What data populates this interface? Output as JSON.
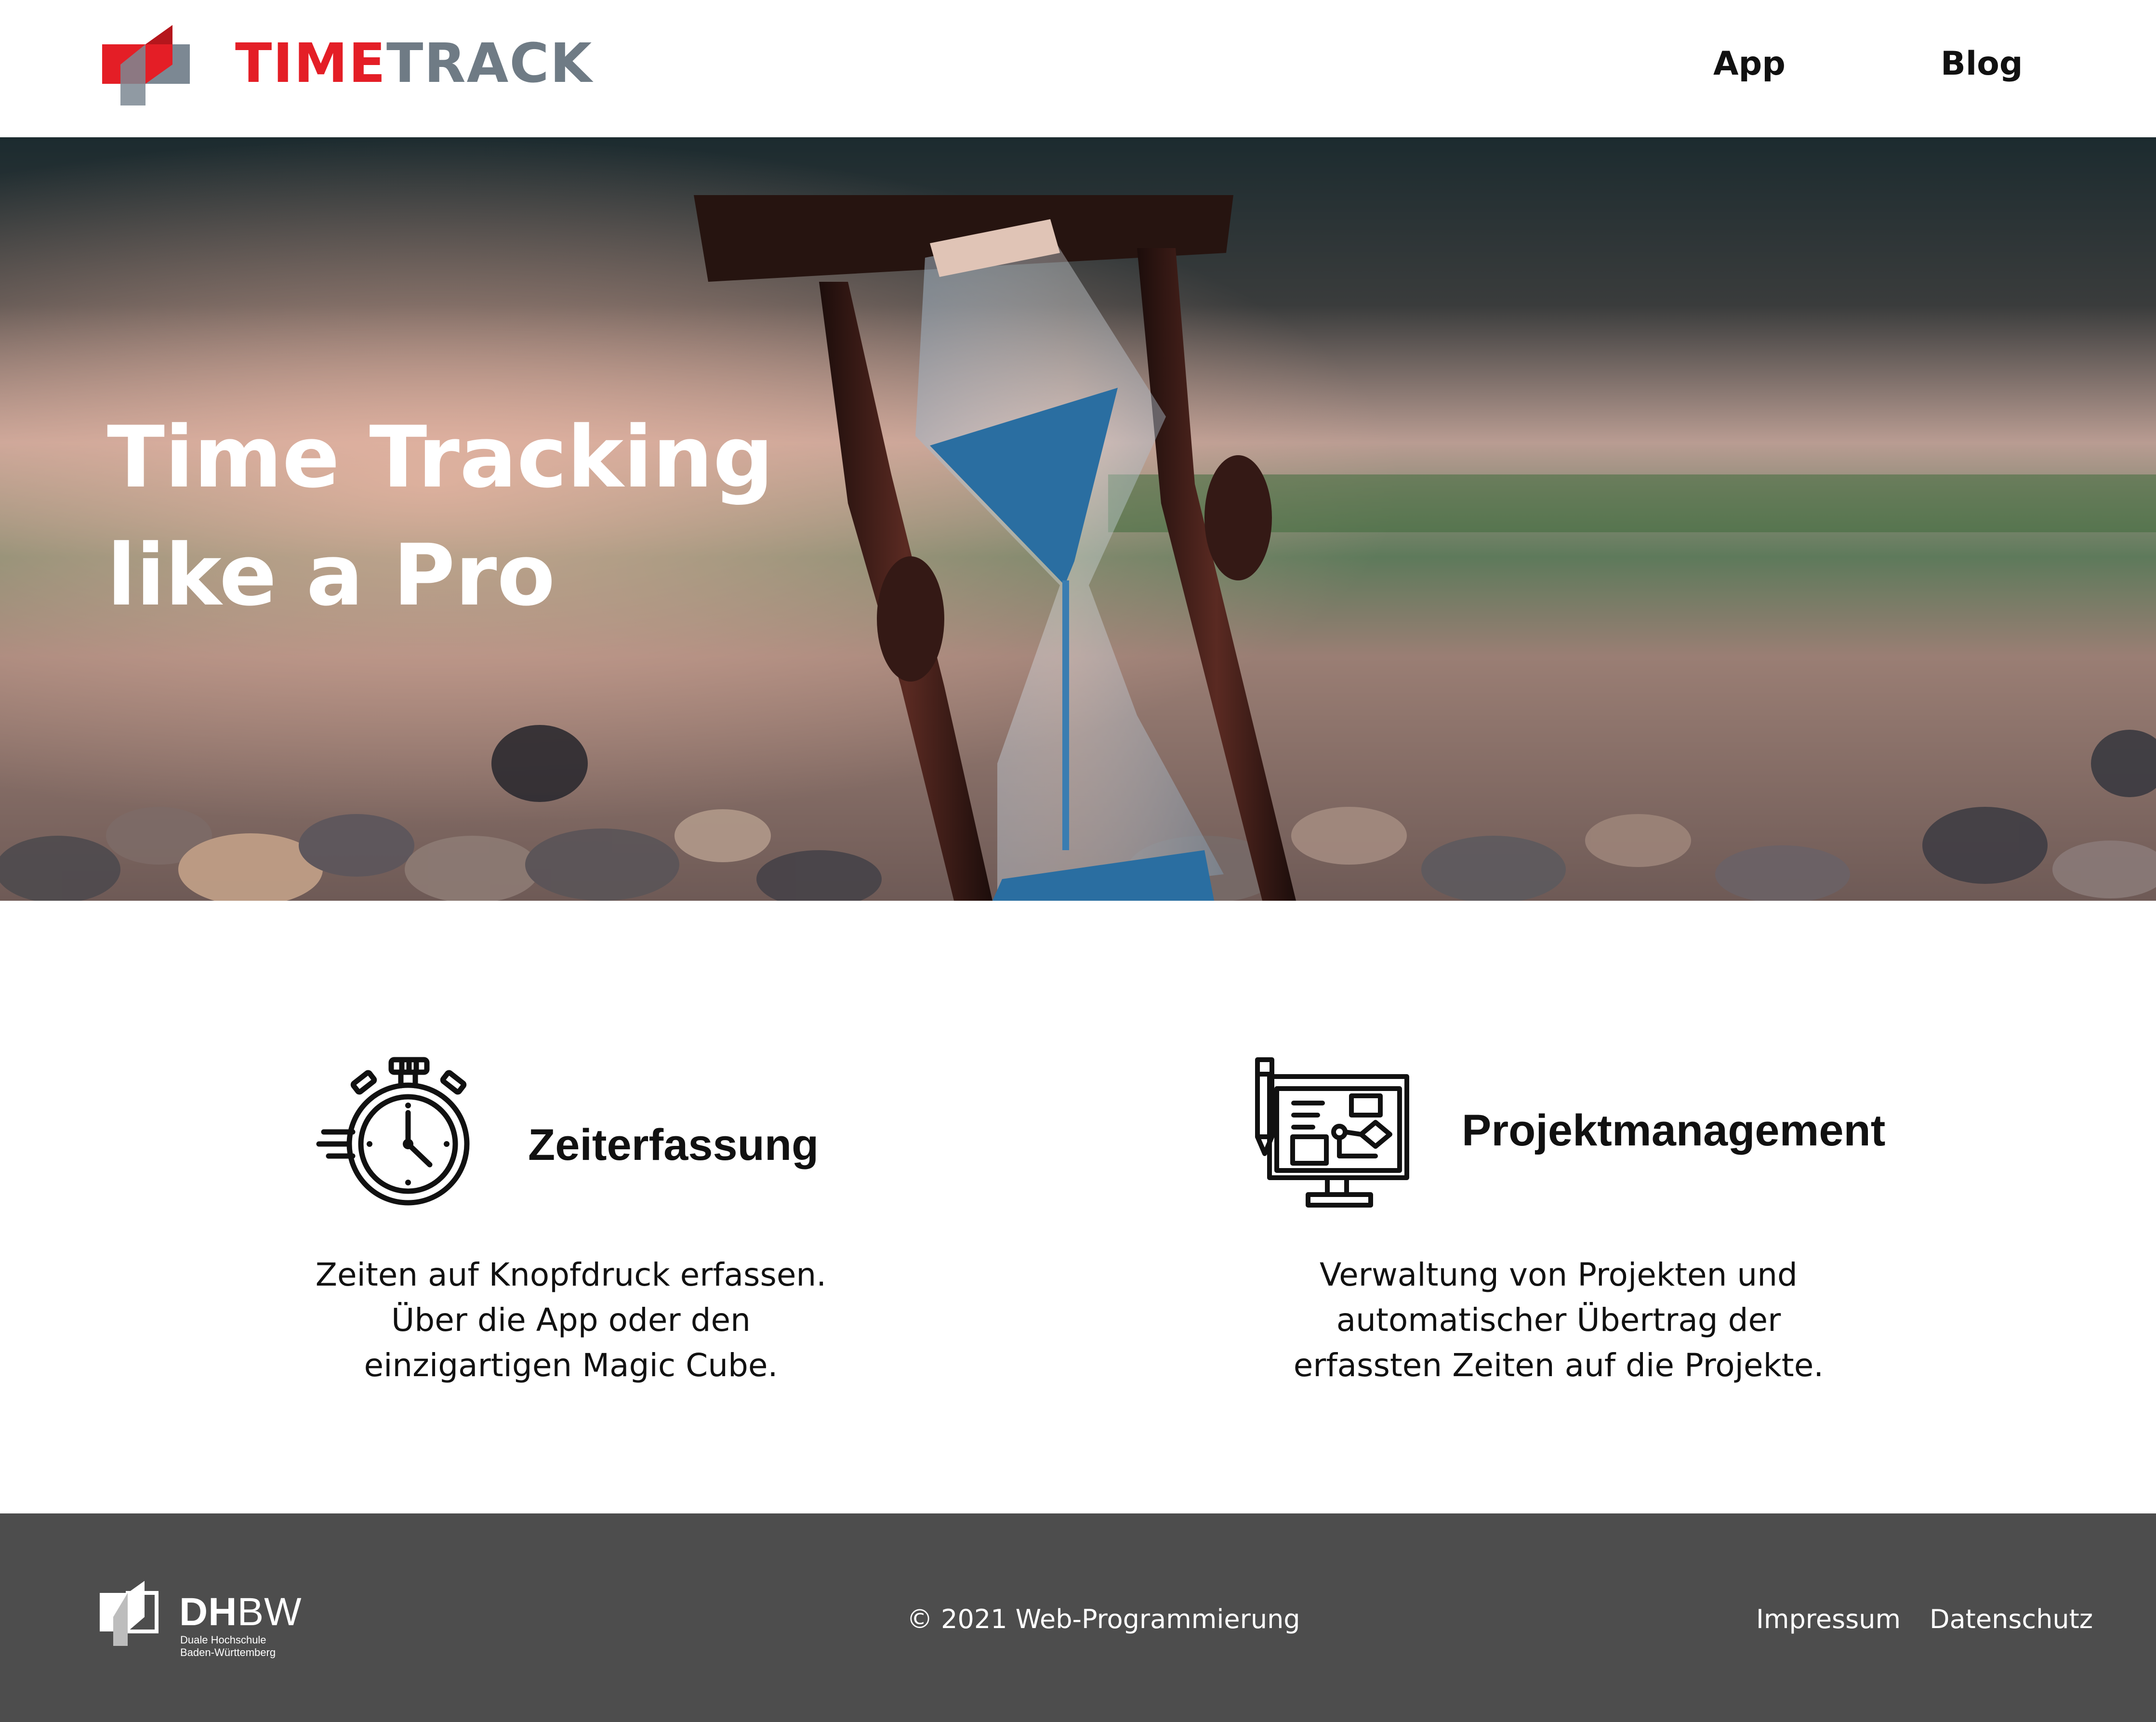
{
  "header": {
    "brand_part1": "TIME",
    "brand_part2": "TRACK",
    "nav": [
      {
        "label": "App"
      },
      {
        "label": "Blog"
      }
    ]
  },
  "hero": {
    "title_line1": "Time Tracking",
    "title_line2": "like a Pro"
  },
  "features": [
    {
      "icon": "stopwatch-icon",
      "title": "Zeiterfassung",
      "lines": [
        "Zeiten auf Knopfdruck erfassen.",
        "Über die App oder den",
        "einzigartigen Magic Cube."
      ]
    },
    {
      "icon": "project-board-icon",
      "title": "Projektmanagement",
      "lines": [
        "Verwaltung von Projekten und",
        "automatischer Übertrag der",
        "erfassten Zeiten auf die Projekte."
      ]
    }
  ],
  "footer": {
    "dhbw_bold": "DH",
    "dhbw_light": "BW",
    "dhbw_sub1": "Duale Hochschule",
    "dhbw_sub2": "Baden-Württemberg",
    "copyright": "© 2021 Web-Programmierung",
    "links": [
      {
        "label": "Impressum"
      },
      {
        "label": "Datenschutz"
      }
    ]
  },
  "colors": {
    "brand_red": "#e41e26",
    "brand_gray": "#6f7b85",
    "footer_bg": "#4d4d4d"
  }
}
